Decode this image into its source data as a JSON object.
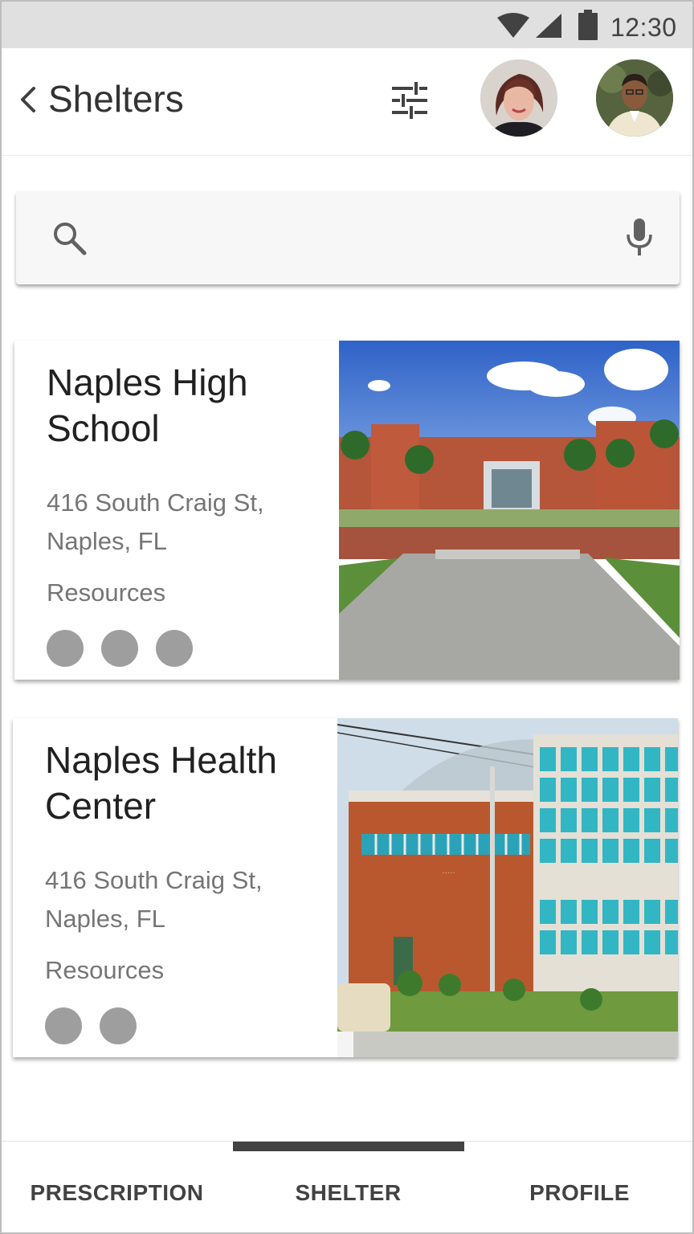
{
  "status_bar": {
    "time": "12:30",
    "icons": [
      "wifi-icon",
      "signal-icon",
      "battery-icon"
    ]
  },
  "app_bar": {
    "title": "Shelters",
    "icons": [
      "back-arrow-icon",
      "filter-sliders-icon"
    ],
    "avatars": [
      "avatar-woman",
      "avatar-man"
    ]
  },
  "search": {
    "placeholder": "",
    "value": "",
    "icons": [
      "search-icon",
      "mic-icon"
    ]
  },
  "shelters": [
    {
      "name": "Naples High School",
      "address": "416 South Craig St, Naples, FL",
      "resources_label": "Resources",
      "resource_count": 3
    },
    {
      "name": "Naples Health Center",
      "address": "416 South Craig St, Naples, FL",
      "resources_label": "Resources",
      "resource_count": 2
    }
  ],
  "bottom_nav": {
    "tabs": [
      {
        "label": "PRESCRIPTION"
      },
      {
        "label": "SHELTER"
      },
      {
        "label": "PROFILE"
      }
    ],
    "active_tab": 1
  },
  "colors": {
    "status_bar": "#e0e0e0",
    "text_primary": "#212121",
    "text_secondary": "#757575",
    "resource_dot": "#9e9e9e",
    "nav_indicator": "#424242"
  }
}
